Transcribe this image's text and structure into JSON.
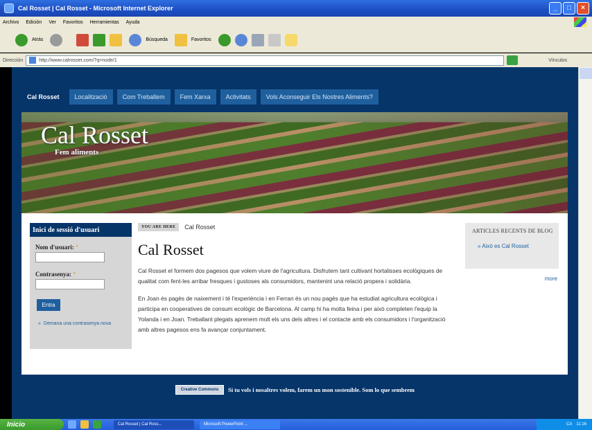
{
  "browser": {
    "title": "Cal Rosset  |  Cal Rosset - Microsoft Internet Explorer",
    "menu": [
      "Archivo",
      "Edición",
      "Ver",
      "Favoritos",
      "Herramientas",
      "Ayuda"
    ],
    "toolbar": {
      "back_label": "Atrás",
      "search_label": "Búsqueda",
      "favorites_label": "Favoritos"
    },
    "address_label": "Dirección",
    "address_value": "http://www.calrosset.com/?q=node/1",
    "links_label": "Vínculos"
  },
  "site": {
    "nav": [
      "Cal Rosset",
      "Localització",
      "Com Treballem",
      "Fem Xarxa",
      "Activitats",
      "Vols Aconseguir Els Nostres Aliments?"
    ],
    "name": "Cal Rosset",
    "slogan": "Fem aliments"
  },
  "login": {
    "title": "Inici de sessió d'usuari",
    "username_label": "Nom d'usuari:",
    "password_label": "Contrasenya:",
    "required_mark": "*",
    "submit_label": "Entra",
    "new_password_link": "Demana una contrasenya nova"
  },
  "main": {
    "you_are_here": "YOU ARE HERE",
    "breadcrumb": "Cal Rosset",
    "title": "Cal Rosset",
    "paragraphs": [
      "Cal Rosset el formem dos pagesos que volem viure de l'agricultura. Disfrutem tant cultivant hortalisses ecològiques de qualitat com fent-les arribar fresques i gustoses als consumidors, mantenint una relació propera i solidària.",
      "En Joan és pagès de naixement i té l'experiència i en Ferran és un nou pagès que ha estudiat agricultura ecològica i participa en cooperatives de consum ecològic de Barcelona. Al camp hi ha molta feina i per això completen l'equip la Yolanda i en Joan. Treballant plegats aprenem molt els uns dels altres i el contacte amb els consumidors i l'organització amb altres pagesos ens fa avançar conjuntament."
    ]
  },
  "sidebar": {
    "recent_title": "ARTICLES RECENTS DE BLOG",
    "recent_items": [
      "Això es Cal Rosset"
    ],
    "more_label": "more"
  },
  "footer": {
    "badge": "Creative Commons",
    "text": "Si tu vols i nosaltres volem, farem un mon sostenible. Som lo que sembrem"
  },
  "taskbar": {
    "start_label": "Inicio",
    "tasks": [
      "Cal Rosset | Cal Ross...",
      "Microsoft PowerPoint ..."
    ],
    "lang": "CA",
    "clock": "11:16"
  }
}
